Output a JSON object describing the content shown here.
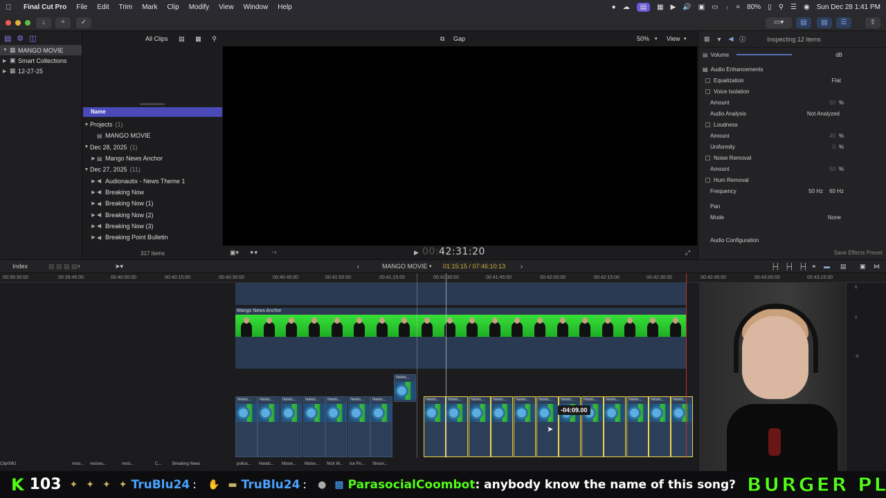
{
  "menubar": {
    "app_name": "Final Cut Pro",
    "items": [
      "File",
      "Edit",
      "Trim",
      "Mark",
      "Clip",
      "Modify",
      "View",
      "Window",
      "Help"
    ],
    "battery": "80%",
    "datetime": "Sun Dec 28  1:41 PM"
  },
  "libraries": {
    "library_name": "MANGO MOVIE",
    "items": [
      {
        "label": "Smart Collections"
      },
      {
        "label": "12-27-25"
      }
    ]
  },
  "browser": {
    "filter": "All Clips",
    "name_header": "Name",
    "rows": [
      {
        "kind": "group",
        "label": "Projects",
        "count": "(1)"
      },
      {
        "kind": "item",
        "label": "MANGO MOVIE",
        "icon": "project-icon"
      },
      {
        "kind": "group",
        "label": "Dec 28, 2025",
        "count": "(1)"
      },
      {
        "kind": "item",
        "label": "Mango News Anchor",
        "icon": "clip-icon"
      },
      {
        "kind": "group",
        "label": "Dec 27, 2025",
        "count": "(11)"
      },
      {
        "kind": "item",
        "label": "Audionautix - News Theme 1",
        "icon": "audio-icon"
      },
      {
        "kind": "item",
        "label": "Breaking Now",
        "icon": "audio-icon"
      },
      {
        "kind": "item",
        "label": "Breaking Now (1)",
        "icon": "audio-icon"
      },
      {
        "kind": "item",
        "label": "Breaking Now (2)",
        "icon": "audio-icon"
      },
      {
        "kind": "item",
        "label": "Breaking Now (3)",
        "icon": "audio-icon"
      },
      {
        "kind": "item",
        "label": "Breaking Point Bulletin",
        "icon": "audio-icon"
      }
    ],
    "item_count": "317 items"
  },
  "viewer": {
    "title": "Gap",
    "zoom": "50%",
    "view_menu": "View",
    "timecode_dim": "00:",
    "timecode": "42:31:20"
  },
  "inspector": {
    "header": "Inspecting 12 items",
    "volume_label": "Volume",
    "volume_unit": "dB",
    "section_enhancements": "Audio Enhancements",
    "equalization_label": "Equalization",
    "equalization_value": "Flat",
    "voice_isolation": "Voice Isolation",
    "amount_label": "Amount",
    "voice_amount": "50",
    "audio_analysis_label": "Audio Analysis",
    "audio_analysis_value": "Not Analyzed",
    "loudness": "Loudness",
    "loudness_amount": "40",
    "uniformity_label": "Uniformity",
    "uniformity_value": "0",
    "noise_removal": "Noise Removal",
    "noise_amount": "50",
    "hum_removal": "Hum Removal",
    "frequency_label": "Frequency",
    "freq_50": "50 Hz",
    "freq_60": "60 Hz",
    "pan_label": "Pan",
    "mode_label": "Mode",
    "mode_value": "None",
    "audio_config": "Audio Configuration",
    "save_preset": "Save Effects Preset",
    "percent": "%"
  },
  "timeline": {
    "index_label": "Index",
    "project_name": "MANGO MOVIE",
    "duration": "01:15:15 / 07:46:10:13",
    "ruler": [
      "00:39:30:00",
      "00:39:45:00",
      "00:40:00:00",
      "00:40:15:00",
      "00:40:30:00",
      "00:40:45:00",
      "00:41:00:00",
      "00:41:15:00",
      "00:41:30:00",
      "00:41:45:00",
      "00:42:00:00",
      "00:42:15:00",
      "00:42:30:00",
      "00:42:45:00",
      "00:43:00:00",
      "00:43:15:00"
    ],
    "anchor_clip": "Mango News Anchor",
    "clip_label": "News...",
    "tooltip": "-04:09.00",
    "meter_labels": [
      "6",
      "0",
      "-6"
    ],
    "bottom_labels": [
      "Clip0061",
      "mois...",
      "moises...",
      "mois...",
      "C...",
      "Breaking News",
      "police...",
      "Handc...",
      "Moise...",
      "Moise...",
      "Nick W...",
      "Ice Po...",
      "Shoov..."
    ]
  },
  "ticker": {
    "count": "103",
    "user_a": "TruBlu24",
    "user_b": "TruBlu24",
    "chat_user": "ParasocialCoombot",
    "chat_message": ": anybody know the name of this song?",
    "brand": "BURGER PLANET",
    "colon": ":"
  }
}
